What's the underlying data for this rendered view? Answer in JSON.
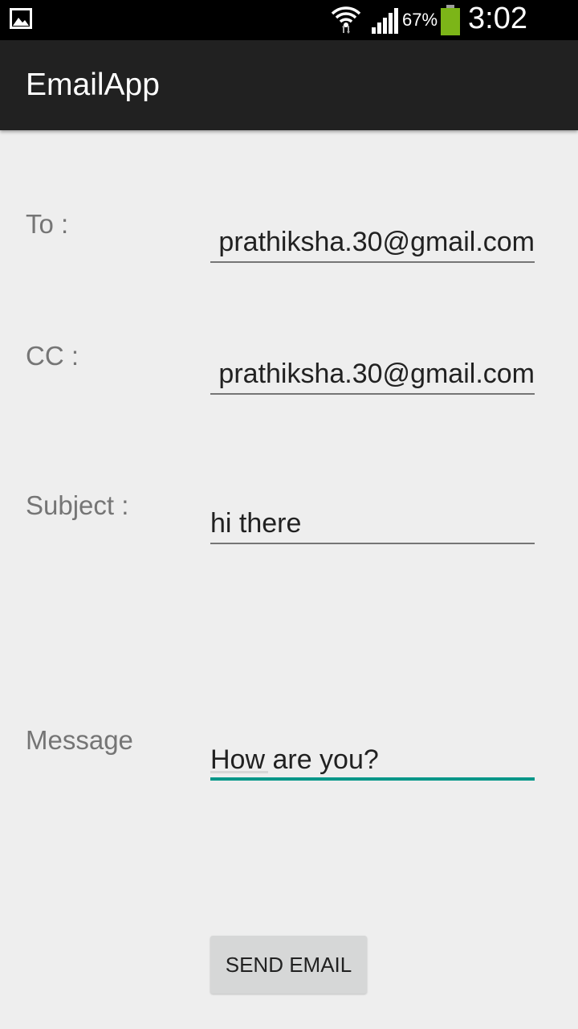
{
  "status_bar": {
    "battery_percent": "67%",
    "time": "3:02 PM",
    "icons": [
      "gallery-icon",
      "wifi-icon",
      "signal-icon",
      "battery-icon"
    ],
    "battery_color": "#7cb518"
  },
  "action_bar": {
    "title": "EmailApp"
  },
  "form": {
    "to_label": "To :",
    "to_value": "prathiksha.30@gmail.com",
    "cc_label": "CC :",
    "cc_value": "prathiksha.30@gmail.com",
    "subject_label": "Subject :",
    "subject_value": "hi there",
    "message_label": "Message",
    "message_value": "How are you?",
    "accent_color": "#009688"
  },
  "send_button": {
    "label": "SEND EMAIL"
  }
}
